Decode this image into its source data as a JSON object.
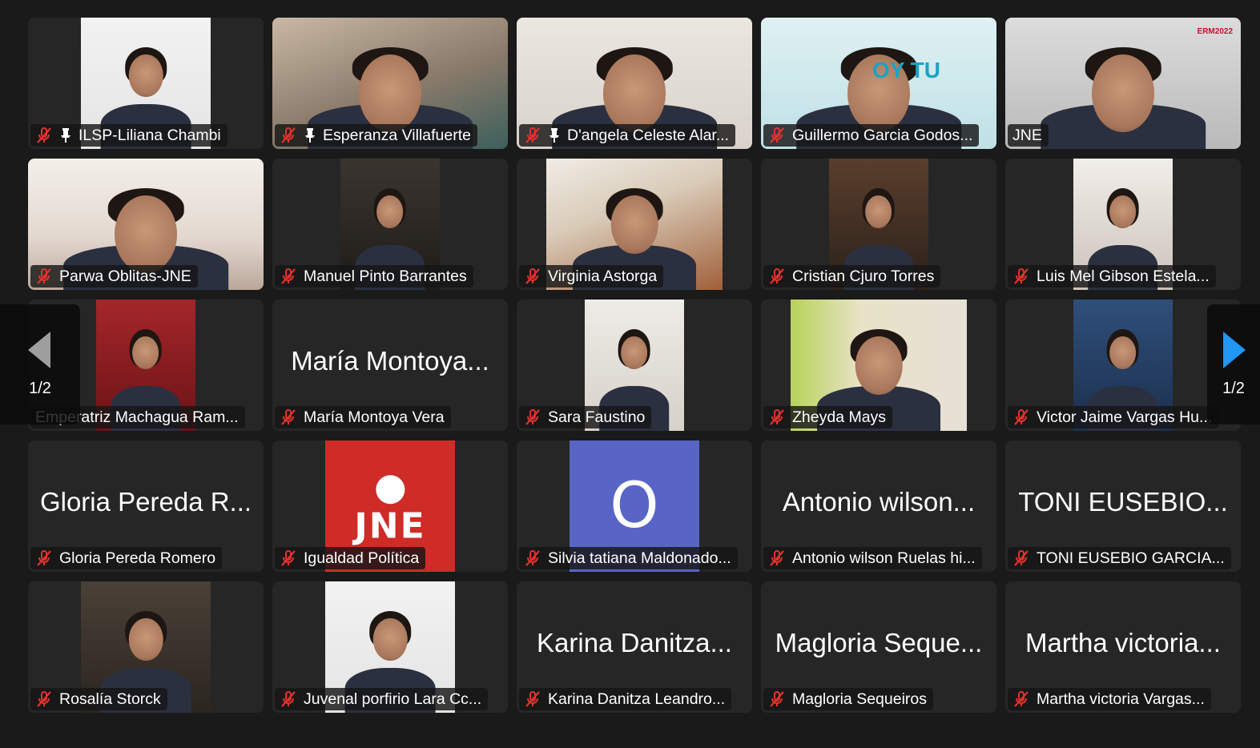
{
  "pagination": {
    "left_page_label": "1/2",
    "right_page_label": "1/2"
  },
  "colors": {
    "active_speaker": "#23c552",
    "next_arrow": "#2196f3",
    "prev_arrow": "#9e9e9e",
    "mute": "#e5322d"
  },
  "participants": [
    {
      "name": "ILSP-Liliana Chambi",
      "muted": true,
      "pinned": true,
      "video": "sq",
      "bg": "bg-white"
    },
    {
      "name": "Esperanza Villafuerte",
      "muted": true,
      "pinned": true,
      "video": "full",
      "bg": "bg-room"
    },
    {
      "name": "D'angela Celeste Alar...",
      "muted": true,
      "pinned": true,
      "video": "full",
      "bg": "bg-beige",
      "active": true
    },
    {
      "name": "Guillermo Garcia Godos...",
      "muted": true,
      "pinned": false,
      "video": "full",
      "bg": "bg-teal",
      "overlay": "OY TU"
    },
    {
      "name": "JNE",
      "muted": false,
      "pinned": false,
      "video": "full",
      "bg": "bg-gray",
      "brand": "ERM2022"
    },
    {
      "name": "Parwa Oblitas-JNE",
      "muted": true,
      "pinned": false,
      "video": "full",
      "bg": "bg-office"
    },
    {
      "name": "Manuel Pinto Barrantes",
      "muted": true,
      "pinned": false,
      "video": "mid",
      "bg": "bg-dark"
    },
    {
      "name": "Virginia Astorga",
      "muted": true,
      "pinned": false,
      "video": "wide",
      "bg": "bg-wood"
    },
    {
      "name": "Cristian Cjuro Torres",
      "muted": true,
      "pinned": false,
      "video": "mid",
      "bg": "bg-brown"
    },
    {
      "name": "Luis Mel Gibson Estela...",
      "muted": true,
      "pinned": false,
      "video": "mid",
      "bg": "bg-light"
    },
    {
      "name": "Emperatriz Machagua Ram...",
      "muted": false,
      "pinned": false,
      "video": "mid",
      "bg": "bg-red"
    },
    {
      "name": "María Montoya Vera",
      "muted": true,
      "pinned": false,
      "display": "María Montoya..."
    },
    {
      "name": "Sara Faustino",
      "muted": true,
      "pinned": false,
      "video": "mid",
      "bg": "bg-wall"
    },
    {
      "name": "Zheyda Mays",
      "muted": true,
      "pinned": false,
      "video": "wide",
      "bg": "bg-poster"
    },
    {
      "name": "Victor Jaime Vargas Hu...",
      "muted": true,
      "pinned": false,
      "video": "mid",
      "bg": "bg-blue"
    },
    {
      "name": "Gloria Pereda Romero",
      "muted": true,
      "pinned": false,
      "display": "Gloria Pereda R..."
    },
    {
      "name": "Igualdad Política",
      "muted": true,
      "pinned": false,
      "video": "sq",
      "bg": "bg-jne",
      "logo": "JNE"
    },
    {
      "name": "Silvia tatiana Maldonado...",
      "muted": true,
      "pinned": false,
      "video": "sq",
      "bg": "bg-avatar",
      "avatar": "O"
    },
    {
      "name": "Antonio wilson Ruelas hi...",
      "muted": true,
      "pinned": false,
      "display": "Antonio wilson..."
    },
    {
      "name": "TONI EUSEBIO GARCIA...",
      "muted": true,
      "pinned": false,
      "display": "TONI EUSEBIO..."
    },
    {
      "name": "Rosalía Storck",
      "muted": true,
      "pinned": false,
      "video": "sq",
      "bg": "bg-dkroom"
    },
    {
      "name": "Juvenal porfirio Lara Cc...",
      "muted": true,
      "pinned": false,
      "video": "sq",
      "bg": "bg-white"
    },
    {
      "name": "Karina Danitza Leandro...",
      "muted": true,
      "pinned": false,
      "display": "Karina Danitza..."
    },
    {
      "name": "Magloria Sequeiros",
      "muted": true,
      "pinned": false,
      "display": "Magloria Seque..."
    },
    {
      "name": "Martha victoria Vargas...",
      "muted": true,
      "pinned": false,
      "display": "Martha victoria..."
    }
  ]
}
